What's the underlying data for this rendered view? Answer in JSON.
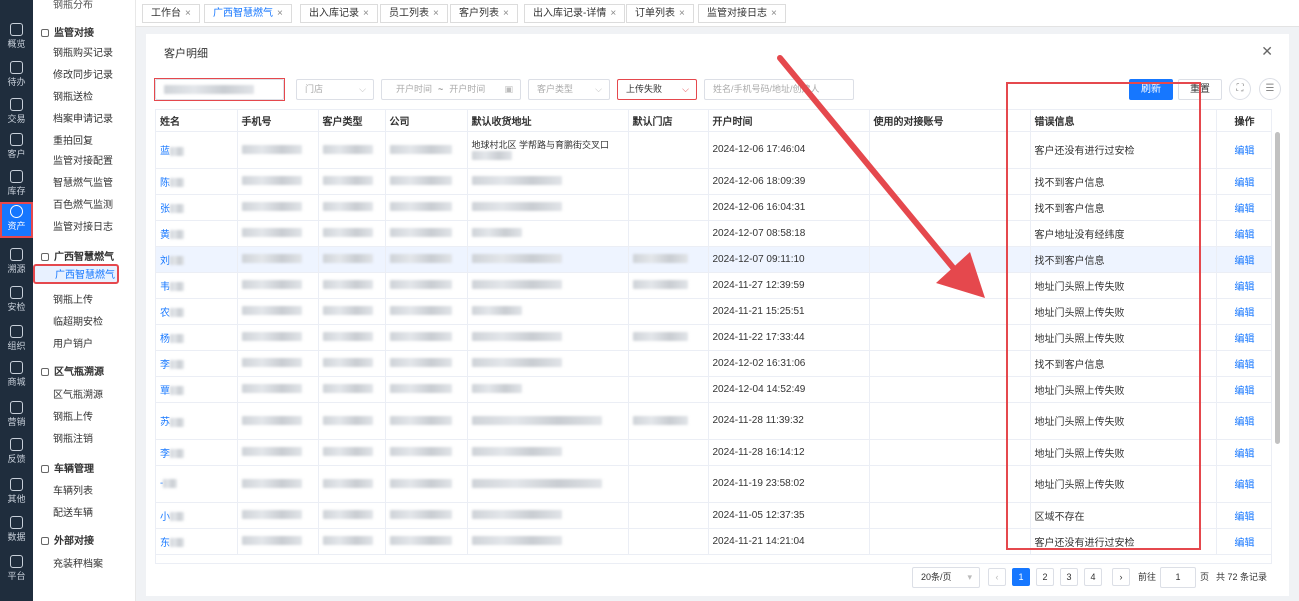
{
  "rail": [
    {
      "label": "概览",
      "icon": "chart-icon"
    },
    {
      "label": "待办",
      "icon": "todo-icon"
    },
    {
      "label": "交易",
      "icon": "bag-icon"
    },
    {
      "label": "客户",
      "icon": "customer-icon"
    },
    {
      "label": "库存",
      "icon": "inventory-icon"
    },
    {
      "label": "资产",
      "icon": "bulb-icon",
      "active": true
    },
    {
      "label": "溯源",
      "icon": "compass-icon"
    },
    {
      "label": "安检",
      "icon": "shield-icon"
    },
    {
      "label": "组织",
      "icon": "org-icon"
    },
    {
      "label": "商城",
      "icon": "shop-icon"
    },
    {
      "label": "营销",
      "icon": "trophy-icon"
    },
    {
      "label": "反馈",
      "icon": "feedback-icon"
    },
    {
      "label": "其他",
      "icon": "more-icon"
    },
    {
      "label": "数据",
      "icon": "data-icon"
    },
    {
      "label": "平台",
      "icon": "platform-icon"
    }
  ],
  "menu": {
    "top_cut": "钢瓶分布",
    "groups": [
      {
        "title": "监管对接",
        "items": [
          "钢瓶购买记录",
          "修改同步记录",
          "钢瓶送检",
          "档案申请记录",
          "重拍回复",
          "监管对接配置",
          "智慧燃气监管",
          "百色燃气监测",
          "监管对接日志"
        ]
      },
      {
        "title": "广西智慧燃气",
        "items": [
          "广西智慧燃气",
          "钢瓶上传",
          "临超期安检",
          "用户销户"
        ],
        "active": "广西智慧燃气"
      },
      {
        "title": "区气瓶溯源",
        "items": [
          "区气瓶溯源",
          "钢瓶上传",
          "钢瓶注销"
        ]
      },
      {
        "title": "车辆管理",
        "items": [
          "车辆列表",
          "配送车辆"
        ]
      },
      {
        "title": "外部对接",
        "items": [
          "充装秤档案"
        ]
      }
    ]
  },
  "tabs": [
    "工作台",
    "广西智慧燃气",
    "出入库记录",
    "员工列表",
    "客户列表",
    "出入库记录-详情",
    "订单列表",
    "监管对接日志"
  ],
  "active_tab": "广西智慧燃气",
  "panel": {
    "title": "客户明细"
  },
  "filters": {
    "store": "门店",
    "date_start": "开户时间",
    "date_sep": "~",
    "date_end": "开户时间",
    "customer_type": "客户类型",
    "status_value": "上传失败",
    "search_placeholder": "姓名/手机号码/地址/创建人",
    "refresh": "刷新",
    "reset": "重置"
  },
  "columns": [
    "姓名",
    "手机号",
    "客户类型",
    "公司",
    "默认收货地址",
    "默认门店",
    "开户时间",
    "使用的对接账号",
    "错误信息",
    "操作"
  ],
  "rows": [
    {
      "name": "蓝",
      "addr_text": "地球村北区 学帮路与育鹏街交叉口",
      "time": "2024-12-06 17:46:04",
      "error": "客户还没有进行过安检",
      "op": "编辑",
      "tall": true
    },
    {
      "name": "陈",
      "time": "2024-12-06 18:09:39",
      "error": "找不到客户信息",
      "op": "编辑"
    },
    {
      "name": "张",
      "time": "2024-12-06 16:04:31",
      "error": "找不到客户信息",
      "op": "编辑"
    },
    {
      "name": "黄",
      "time": "2024-12-07 08:58:18",
      "error": "客户地址没有经纬度",
      "op": "编辑"
    },
    {
      "name": "刘",
      "time": "2024-12-07 09:11:10",
      "error": "找不到客户信息",
      "op": "编辑",
      "hl": true
    },
    {
      "name": "韦",
      "time": "2024-11-27 12:39:59",
      "error": "地址门头照上传失败",
      "op": "编辑"
    },
    {
      "name": "农",
      "time": "2024-11-21 15:25:51",
      "error": "地址门头照上传失败",
      "op": "编辑"
    },
    {
      "name": "杨",
      "time": "2024-11-22 17:33:44",
      "error": "地址门头照上传失败",
      "op": "编辑"
    },
    {
      "name": "李",
      "time": "2024-12-02 16:31:06",
      "error": "找不到客户信息",
      "op": "编辑"
    },
    {
      "name": "覃",
      "time": "2024-12-04 14:52:49",
      "error": "地址门头照上传失败",
      "op": "编辑"
    },
    {
      "name": "苏",
      "time": "2024-11-28 11:39:32",
      "error": "地址门头照上传失败",
      "op": "编辑",
      "tall": true
    },
    {
      "name": "李",
      "time": "2024-11-28 16:14:12",
      "error": "地址门头照上传失败",
      "op": "编辑"
    },
    {
      "name": "-",
      "time": "2024-11-19 23:58:02",
      "error": "地址门头照上传失败",
      "op": "编辑",
      "tall": true
    },
    {
      "name": "小",
      "time": "2024-11-05 12:37:35",
      "error": "区域不存在",
      "op": "编辑"
    },
    {
      "name": "东",
      "time": "2024-11-21 14:21:04",
      "error": "客户还没有进行过安检",
      "op": "编辑"
    }
  ],
  "pagination": {
    "page_size": "20条/页",
    "pages": [
      "1",
      "2",
      "3",
      "4"
    ],
    "current": "1",
    "goto_label": "前往",
    "goto_value": "1",
    "page_unit": "页",
    "total": "共 72 条记录"
  },
  "colors": {
    "accent": "#1677ff",
    "annotation": "#e5484d",
    "rail": "#1f2d3d"
  }
}
